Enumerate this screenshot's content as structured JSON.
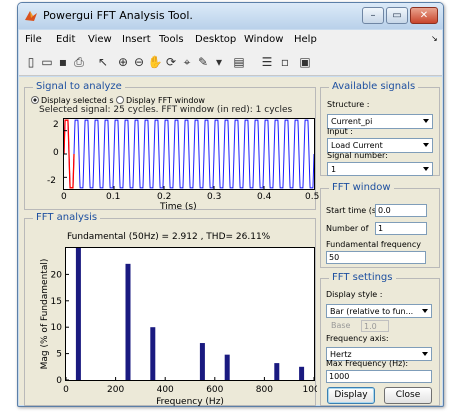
{
  "window": {
    "title": "Powergui FFT Analysis Tool.",
    "minimize": "–",
    "maximize": "▭",
    "close": "✕"
  },
  "menu": [
    "File",
    "Edit",
    "View",
    "Insert",
    "Tools",
    "Desktop",
    "Window",
    "Help"
  ],
  "menu_overflow": "↘",
  "toolbar": [
    {
      "name": "new-file-icon",
      "glyph": "▯"
    },
    {
      "name": "open-folder-icon",
      "glyph": "▭"
    },
    {
      "name": "save-icon",
      "glyph": "▪"
    },
    {
      "name": "print-icon",
      "glyph": "⎙"
    },
    {
      "name": "pointer-icon",
      "glyph": "↖"
    },
    {
      "name": "zoom-in-icon",
      "glyph": "⊕"
    },
    {
      "name": "zoom-out-icon",
      "glyph": "⊖"
    },
    {
      "name": "pan-icon",
      "glyph": "✋"
    },
    {
      "name": "rotate-icon",
      "glyph": "⟳"
    },
    {
      "name": "data-cursor-icon",
      "glyph": "⌖"
    },
    {
      "name": "brush-icon",
      "glyph": "✎"
    },
    {
      "name": "link-icon",
      "glyph": "▾"
    },
    {
      "name": "insert-colorbar-icon",
      "glyph": "▤"
    },
    {
      "name": "insert-legend-icon",
      "glyph": "☰"
    },
    {
      "name": "hide-plot-tools-icon",
      "glyph": "▫"
    },
    {
      "name": "show-plot-tools-icon",
      "glyph": "▣"
    }
  ],
  "signal_panel": {
    "title": "Signal to analyze",
    "radio_selected": "Display selected s",
    "radio_fft": "Display FFT window",
    "info": "Selected signal: 25 cycles. FFT window (in red): 1 cycles",
    "xlabel": "Time (s)",
    "x_ticks": [
      "0",
      "0.1",
      "0.2",
      "0.3",
      "0.4",
      "0.5"
    ],
    "y_ticks": [
      "2",
      "0",
      "-2"
    ]
  },
  "fft_panel": {
    "title": "FFT analysis",
    "header": "Fundamental (50Hz) = 2.912 , THD= 26.11%"
  },
  "available_signals": {
    "title": "Available signals",
    "structure_label": "Structure :",
    "structure_value": "Current_pi",
    "input_label": "Input :",
    "input_value": "Load Current",
    "signal_number_label": "Signal number:",
    "signal_number_value": "1"
  },
  "fft_window": {
    "title": "FFT window",
    "start_time_label": "Start time (s",
    "start_time_value": "0.0",
    "num_cycles_label": "Number of",
    "num_cycles_value": "1",
    "fund_freq_label": "Fundamental frequency",
    "fund_freq_value": "50"
  },
  "fft_settings": {
    "title": "FFT settings",
    "display_style_label": "Display style :",
    "display_style_value": "Bar (relative to fun...",
    "base_label": "Base",
    "base_value": "1.0",
    "freq_axis_label": "Frequency axis:",
    "freq_axis_value": "Hertz",
    "max_freq_label": "Max Frequency (Hz):",
    "max_freq_value": "1000",
    "display_button": "Display",
    "close_button": "Close"
  },
  "chart_data": [
    {
      "type": "line",
      "title": "Selected signal: 25 cycles. FFT window (in red): 1 cycles",
      "xlabel": "Time (s)",
      "ylabel": "",
      "xlim": [
        0,
        0.5
      ],
      "ylim": [
        -3,
        3
      ],
      "grid": false,
      "legend": "none",
      "series": [
        {
          "name": "",
          "color": "#1a1aff",
          "fundamental_hz": 50,
          "amplitude": 2.9,
          "wave": "clipped-sine",
          "x_range": [
            0,
            0.5
          ]
        },
        {
          "name": "",
          "color": "#ff0000",
          "fundamental_hz": 50,
          "amplitude": 2.9,
          "wave": "clipped-sine",
          "x_range": [
            0,
            0.02
          ]
        }
      ]
    },
    {
      "type": "bar",
      "title": "Fundamental (50Hz) = 2.912 , THD= 26.11%",
      "xlabel": "Frequency (Hz)",
      "ylabel": "Mag (% of Fundamental)",
      "xlim": [
        0,
        1000
      ],
      "ylim": [
        0,
        25
      ],
      "grid": false,
      "legend": "none",
      "bar_color": "#1a1a80",
      "x_ticks": [
        0,
        200,
        400,
        600,
        800,
        1000
      ],
      "y_ticks": [
        0,
        5,
        10,
        15,
        20
      ],
      "x": [
        50,
        250,
        350,
        550,
        650,
        850,
        950
      ],
      "values": [
        100,
        22,
        10,
        7,
        4.8,
        3.2,
        2.5
      ]
    }
  ]
}
